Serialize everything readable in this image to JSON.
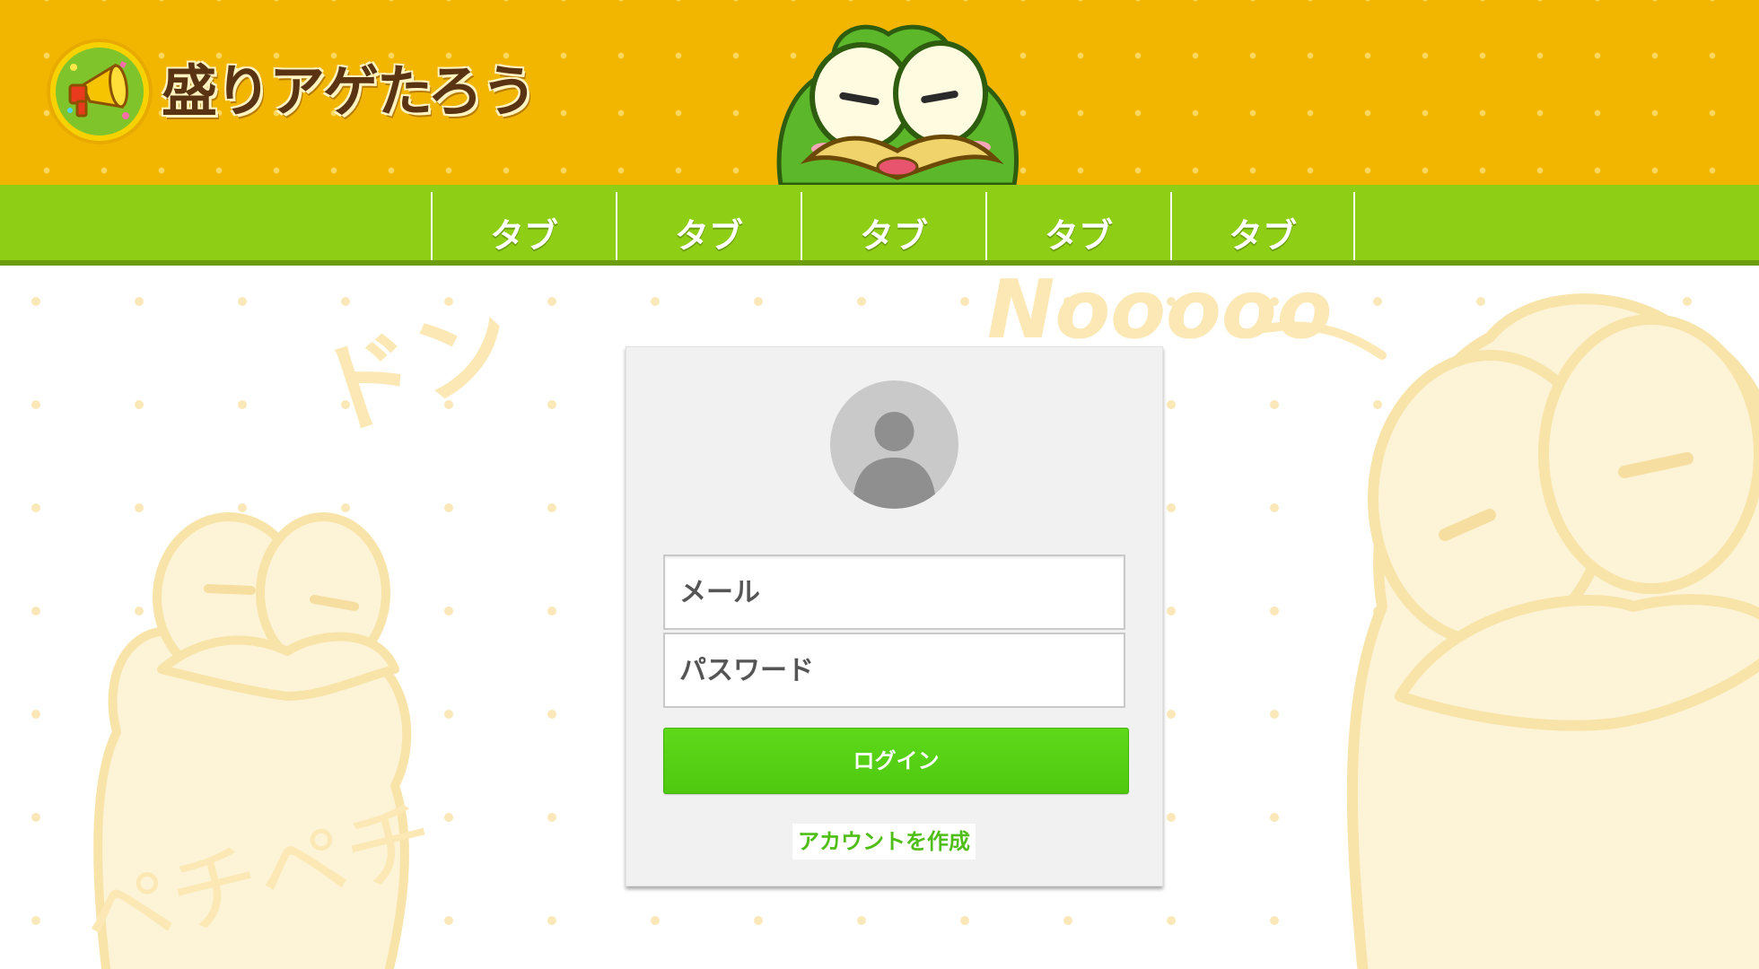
{
  "header": {
    "brand": "盛りアゲたろう",
    "logo_icon": "megaphone-icon",
    "mascot_icon": "frog-mascot-icon"
  },
  "nav": {
    "tabs": [
      {
        "label": "タブ"
      },
      {
        "label": "タブ"
      },
      {
        "label": "タブ"
      },
      {
        "label": "タブ"
      },
      {
        "label": "タブ"
      }
    ]
  },
  "login": {
    "avatar_icon": "user-avatar-icon",
    "email_placeholder": "メール",
    "password_placeholder": "パスワード",
    "login_label": "ログイン",
    "create_account_label": "アカウントを作成"
  },
  "background_text": {
    "don": "ドン",
    "nooo": "Nooooo",
    "pechi": "ペチペチ"
  },
  "colors": {
    "header_bg": "#f2b600",
    "nav_bg": "#8ece14",
    "button_green": "#52cf12",
    "link_green": "#4fbe16"
  }
}
